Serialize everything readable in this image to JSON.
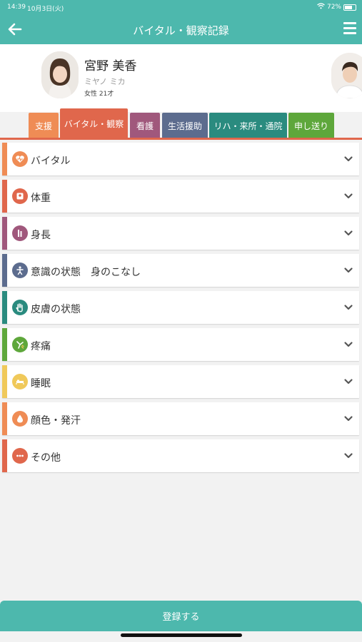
{
  "status": {
    "time": "14:39",
    "date": "10月3日(火)",
    "battery": "72%",
    "battery_level": 0.72
  },
  "nav": {
    "title": "バイタル・観察記録"
  },
  "profile": {
    "name": "宮野 美香",
    "kana": "ミヤノ ミカ",
    "meta": "女性 21才"
  },
  "tabs": [
    {
      "label": "支援",
      "color": "#ef8c55"
    },
    {
      "label": "バイタル・観察",
      "color": "#e0674c"
    },
    {
      "label": "看護",
      "color": "#a0587c"
    },
    {
      "label": "生活援助",
      "color": "#5c6c8e"
    },
    {
      "label": "リハ・来所・通院",
      "color": "#2a8b7f"
    },
    {
      "label": "申し送り",
      "color": "#5ea73b"
    }
  ],
  "items": [
    {
      "label": "バイタル",
      "color": "#ef8c55",
      "icon": "heart-icon"
    },
    {
      "label": "体重",
      "color": "#e0674c",
      "icon": "scale-icon"
    },
    {
      "label": "身長",
      "color": "#a0587c",
      "icon": "height-icon"
    },
    {
      "label": "意識の状態　身のこなし",
      "color": "#5c6c8e",
      "icon": "person-icon"
    },
    {
      "label": "皮膚の状態",
      "color": "#2a8b7f",
      "icon": "hand-icon"
    },
    {
      "label": "疼痛",
      "color": "#5ea73b",
      "icon": "pain-icon"
    },
    {
      "label": "睡眠",
      "color": "#f0c95a",
      "icon": "bed-icon"
    },
    {
      "label": "顔色・発汗",
      "color": "#ef8c55",
      "icon": "drop-icon"
    },
    {
      "label": "その他",
      "color": "#e0674c",
      "icon": "more-icon"
    }
  ],
  "register_label": "登録する"
}
